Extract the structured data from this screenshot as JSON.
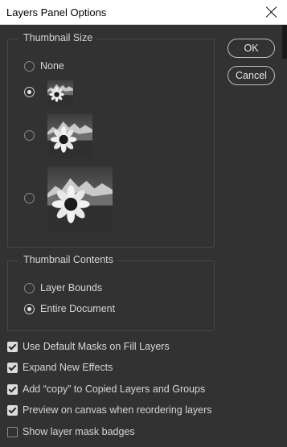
{
  "window": {
    "title": "Layers Panel Options"
  },
  "buttons": {
    "ok": "OK",
    "cancel": "Cancel"
  },
  "thumbnail_size": {
    "legend": "Thumbnail Size",
    "options": [
      {
        "label": "None",
        "selected": false
      },
      {
        "label": "",
        "preview": "sunflower-small",
        "selected": true
      },
      {
        "label": "",
        "preview": "sunflower-medium",
        "selected": false
      },
      {
        "label": "",
        "preview": "sunflower-large",
        "selected": false
      }
    ]
  },
  "thumbnail_contents": {
    "legend": "Thumbnail Contents",
    "options": [
      {
        "label": "Layer Bounds",
        "selected": false
      },
      {
        "label": "Entire Document",
        "selected": true
      }
    ]
  },
  "checkboxes": [
    {
      "label": "Use Default Masks on Fill Layers",
      "checked": true
    },
    {
      "label": "Expand New Effects",
      "checked": true
    },
    {
      "label": "Add “copy” to Copied Layers and Groups",
      "checked": true
    },
    {
      "label": "Preview on canvas when reordering layers",
      "checked": true
    },
    {
      "label": "Show layer mask badges",
      "checked": false
    }
  ],
  "colors": {
    "background": "#323232",
    "titlebar": "#ffffff",
    "text": "#d6d6d6",
    "border": "#484848"
  }
}
